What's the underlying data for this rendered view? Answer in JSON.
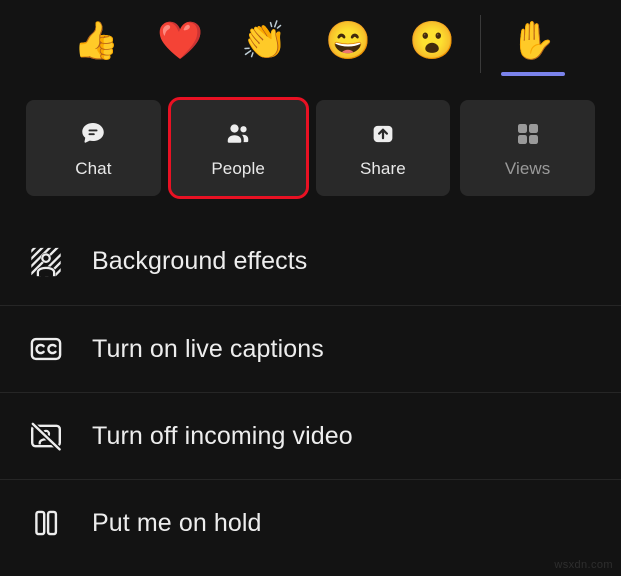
{
  "reactions": {
    "items": [
      {
        "name": "thumbs-up",
        "glyph": "👍",
        "active": false
      },
      {
        "name": "heart",
        "glyph": "❤️",
        "active": false
      },
      {
        "name": "applause",
        "glyph": "👏",
        "active": false
      },
      {
        "name": "laugh",
        "glyph": "😄",
        "active": false
      },
      {
        "name": "surprised",
        "glyph": "😮",
        "active": false
      },
      {
        "name": "raise-hand",
        "glyph": "✋",
        "active": true
      }
    ],
    "active_color": "#7b83eb"
  },
  "actions": {
    "buttons": [
      {
        "label": "Chat",
        "icon": "chat-icon",
        "selected": false,
        "disabled": false
      },
      {
        "label": "People",
        "icon": "people-icon",
        "selected": true,
        "disabled": false
      },
      {
        "label": "Share",
        "icon": "share-icon",
        "selected": false,
        "disabled": false
      },
      {
        "label": "Views",
        "icon": "views-icon",
        "selected": false,
        "disabled": true
      }
    ],
    "selected_border_color": "#e81123"
  },
  "options": [
    {
      "label": "Background effects",
      "icon": "background-effects-icon"
    },
    {
      "label": "Turn on live captions",
      "icon": "closed-captions-icon"
    },
    {
      "label": "Turn off incoming video",
      "icon": "video-off-icon"
    },
    {
      "label": "Put me on hold",
      "icon": "pause-icon"
    }
  ],
  "watermark": {
    "text": "wsxdn.com"
  }
}
